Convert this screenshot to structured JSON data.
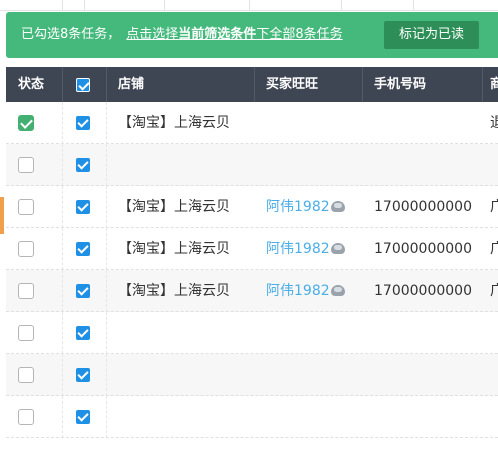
{
  "banner": {
    "prefix": "已勾选8条任务，",
    "link_pre": "点击选择",
    "link_bold": "当前筛选条件",
    "link_post": "下全部8条任务",
    "mark_button": "标记为已读"
  },
  "table": {
    "headers": {
      "status": "状态",
      "shop": "店铺",
      "buyer": "买家旺旺",
      "phone": "手机号码",
      "next_clipped": "商"
    },
    "rows": [
      {
        "status_checked": true,
        "selected": true,
        "shop": "【淘宝】上海云贝",
        "buyer": "",
        "phone": "",
        "next_clipped": "退"
      },
      {
        "status_checked": false,
        "selected": true,
        "shop": "",
        "buyer": "",
        "phone": "",
        "next_clipped": ""
      },
      {
        "status_checked": false,
        "selected": true,
        "shop": "【淘宝】上海云贝",
        "buyer": "阿伟1982",
        "phone": "17000000000",
        "next_clipped": "广"
      },
      {
        "status_checked": false,
        "selected": true,
        "shop": "【淘宝】上海云贝",
        "buyer": "阿伟1982",
        "phone": "17000000000",
        "next_clipped": "广"
      },
      {
        "status_checked": false,
        "selected": true,
        "shop": "【淘宝】上海云贝",
        "buyer": "阿伟1982",
        "phone": "17000000000",
        "next_clipped": "广"
      },
      {
        "status_checked": false,
        "selected": true,
        "shop": "",
        "buyer": "",
        "phone": "",
        "next_clipped": ""
      },
      {
        "status_checked": false,
        "selected": true,
        "shop": "",
        "buyer": "",
        "phone": "",
        "next_clipped": ""
      },
      {
        "status_checked": false,
        "selected": true,
        "shop": "",
        "buyer": "",
        "phone": "",
        "next_clipped": ""
      }
    ]
  },
  "colors": {
    "banner_bg": "#45b97c",
    "mark_button_bg": "#2d8f57",
    "header_bg": "#3e4553",
    "checkbox_blue": "#1e90e6",
    "status_green": "#43b072",
    "link_blue": "#4aaee8",
    "row_marker": "#f0a04b"
  },
  "icons": {
    "buyer_avatar": "wangwang-avatar-icon",
    "status_check": "check-icon"
  }
}
